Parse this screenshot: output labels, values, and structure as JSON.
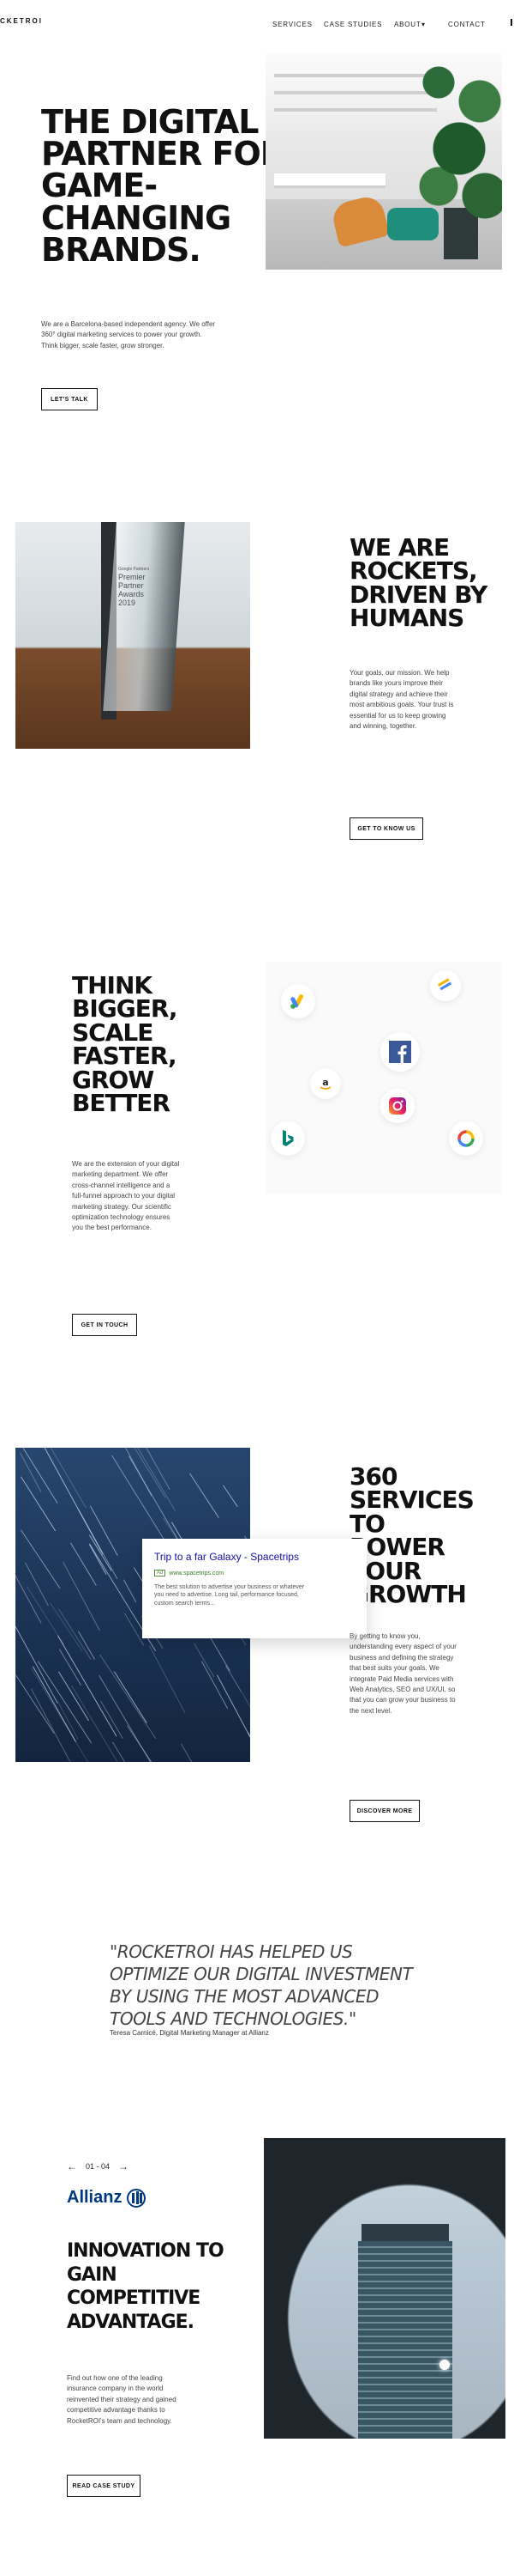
{
  "nav": {
    "logo": "CKETROI",
    "items": [
      {
        "label": "SERVICES"
      },
      {
        "label": "CASE STUDIES"
      },
      {
        "label": "ABOUT"
      },
      {
        "label": "CONTACT"
      }
    ],
    "about_caret": "▾"
  },
  "hero": {
    "headline_lines": [
      "THE DIGITAL",
      "PARTNER FOR",
      "GAME-",
      "CHANGING",
      "BRANDS."
    ],
    "body_lines": [
      "We are a Barcelona-based independent agency. We offer",
      "360° digital marketing services to power your growth.",
      "Think bigger, scale faster, grow stronger."
    ],
    "cta": "LET'S TALK"
  },
  "rockets": {
    "headline_lines": [
      "WE ARE",
      "ROCKETS,",
      "DRIVEN BY",
      "HUMANS"
    ],
    "body_lines": [
      "Your goals, our mission. We help",
      "brands like yours improve their",
      "digital strategy and achieve their",
      "most ambitious goals. Your trust is",
      "essential for us to keep growing",
      "and winning, together."
    ],
    "cta": "GET TO KNOW US",
    "award_small": "Google Partners",
    "award_lines": [
      "Premier",
      "Partner",
      "Awards",
      "2019"
    ]
  },
  "think": {
    "headline_lines": [
      "THINK",
      "BIGGER,",
      "SCALE",
      "FASTER,",
      "GROW",
      "BETTER"
    ],
    "body_lines": [
      "We are the extension of your digital",
      "marketing department. We offer",
      "cross-channel intelligence and a",
      "full-funnel approach to your digital",
      "marketing strategy. Our scientific",
      "optimization technology ensures",
      "you the best performance."
    ],
    "cta": "GET IN TOUCH",
    "logos": [
      "google-ads-icon",
      "google-tag-manager-icon",
      "facebook-icon",
      "amazon-icon",
      "instagram-icon",
      "bing-icon",
      "google-optimize-icon"
    ]
  },
  "services": {
    "headline_lines": [
      "360",
      "SERVICES TO",
      "POWER",
      "YOUR",
      "GROWTH"
    ],
    "body_lines": [
      "By getting to know you,",
      "understanding every aspect of your",
      "business and defining the strategy",
      "that best suits your goals. We",
      "integrate Paid Media services with",
      "Web Analytics, SEO and UX/UI, so",
      "that you can grow your business to",
      "the next level."
    ],
    "cta": "DISCOVER MORE",
    "ad": {
      "title": "Trip to a far Galaxy - Spacetrips",
      "tag": "Ad",
      "url": "www.spacetrips.com",
      "desc_lines": [
        "The best solution to advertise your business or whatever",
        "you need to advertise. Long tail, performance focused,",
        "custom search terms..."
      ]
    }
  },
  "quote": {
    "text": "\"ROCKETROI HAS HELPED US OPTIMIZE OUR DIGITAL INVESTMENT BY USING THE MOST ADVANCED TOOLS AND TECHNOLOGIES.\"",
    "author": "Teresa Carnicé, Digital Marketing Manager at Allianz"
  },
  "case": {
    "pager": "01 - 04",
    "prev": "←",
    "next": "→",
    "client": "Allianz",
    "headline_lines": [
      "INNOVATION TO",
      "GAIN",
      "COMPETITIVE",
      "ADVANTAGE."
    ],
    "body_lines": [
      "Find out how one of the leading",
      "insurance company in the world",
      "reinvented their strategy and gained",
      "competitive advantage thanks to",
      "RocketROI's team and technology."
    ],
    "cta": "READ CASE STUDY"
  }
}
